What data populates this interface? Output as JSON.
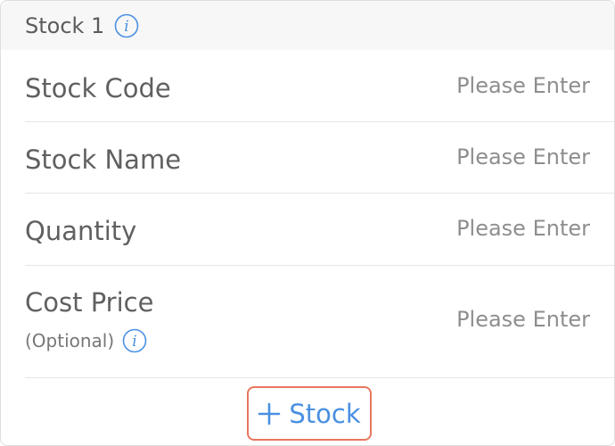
{
  "header": {
    "title": "Stock 1",
    "info_icon": "info-icon"
  },
  "rows": [
    {
      "label": "Stock Code",
      "placeholder": "Please Enter"
    },
    {
      "label": "Stock Name",
      "placeholder": "Please Enter"
    },
    {
      "label": "Quantity",
      "placeholder": "Please Enter"
    },
    {
      "label": "Cost Price",
      "sublabel": "(Optional)",
      "placeholder": "Please Enter"
    }
  ],
  "add_button": {
    "label": "Stock",
    "icon": "plus-icon"
  },
  "colors": {
    "accent": "#4a90e2",
    "button_border": "#e8765e",
    "header_bg": "#f7f7f7"
  }
}
